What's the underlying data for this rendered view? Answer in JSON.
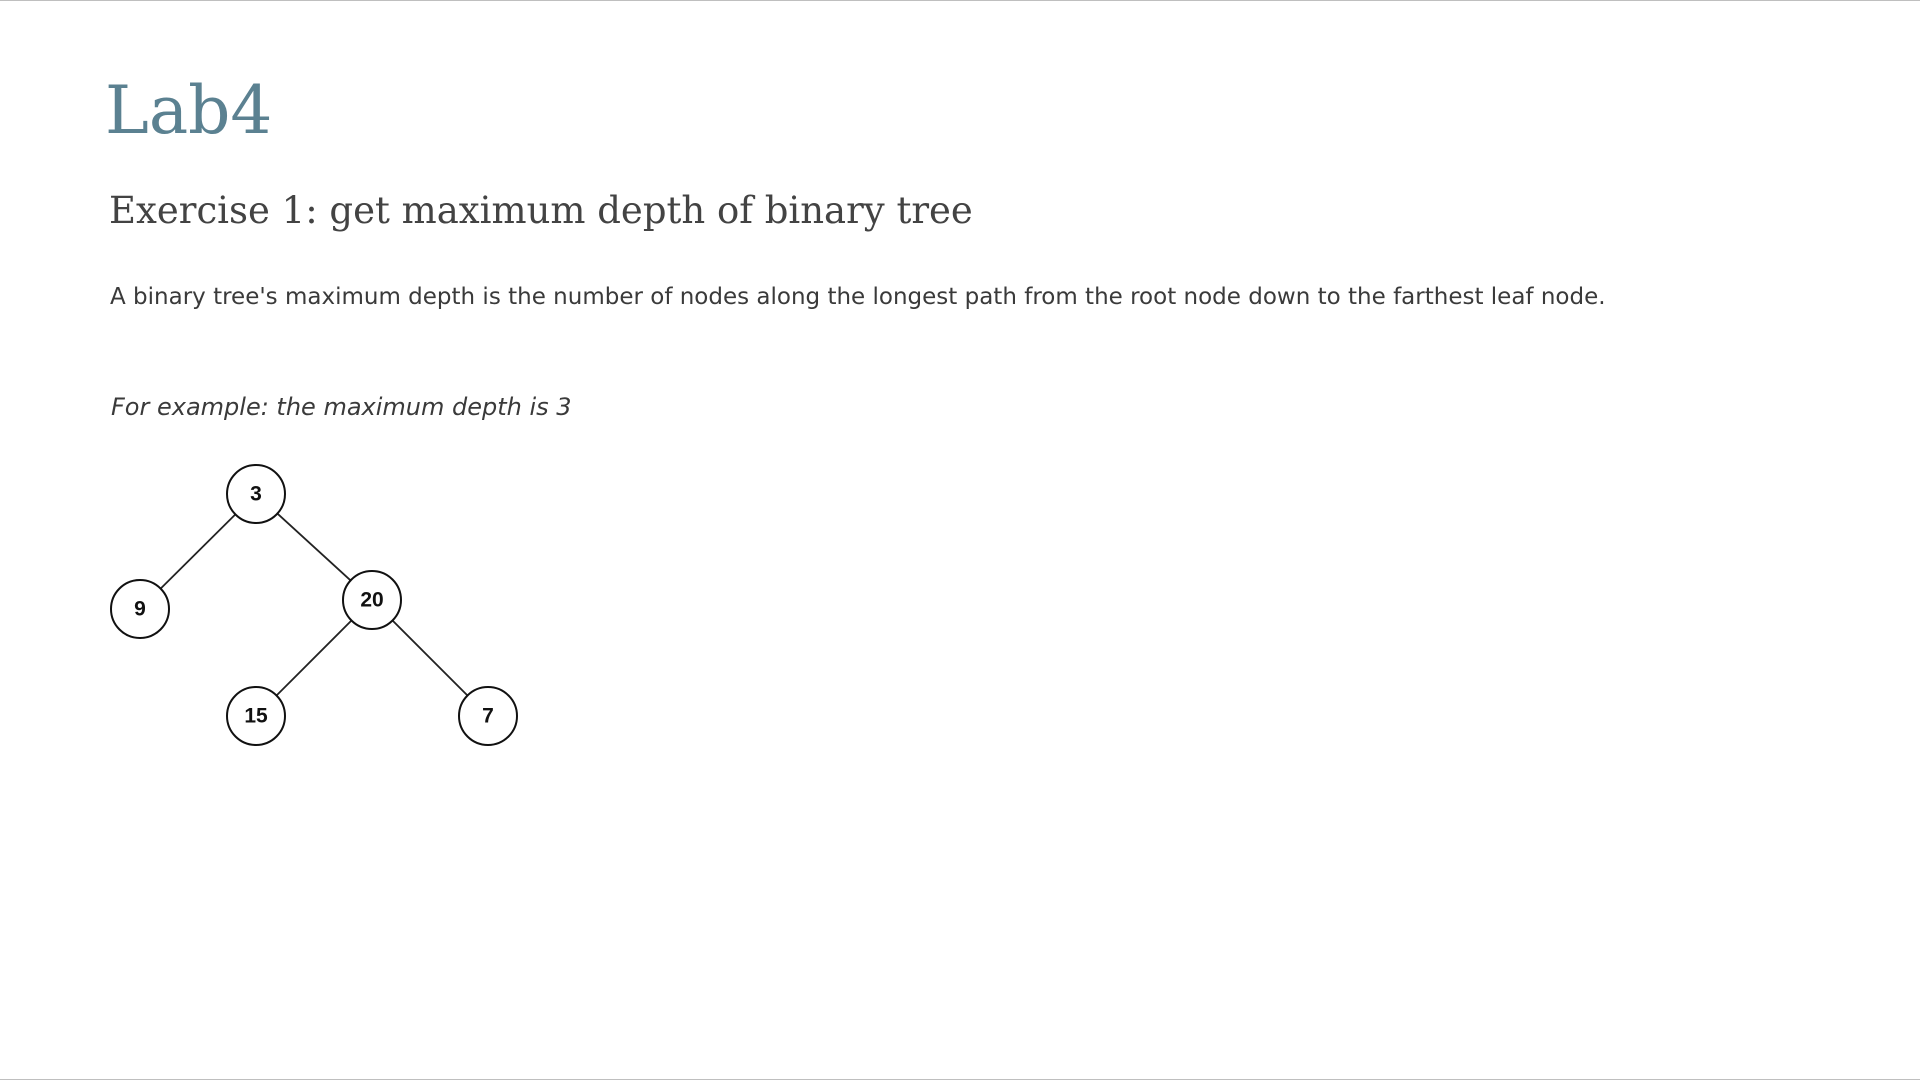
{
  "document": {
    "title": "Lab4",
    "exercise_heading": "Exercise 1: get maximum depth of binary tree",
    "description": "A binary tree's maximum depth is the number of nodes along the longest path from the root node down to the farthest leaf node.",
    "example_caption": "For example: the maximum depth is 3"
  },
  "tree": {
    "nodes": [
      {
        "id": "root",
        "label": "3"
      },
      {
        "id": "left",
        "label": "9"
      },
      {
        "id": "right",
        "label": "20"
      },
      {
        "id": "right-left",
        "label": "15"
      },
      {
        "id": "right-right",
        "label": "7"
      }
    ],
    "edges": [
      {
        "from": "root",
        "to": "left"
      },
      {
        "from": "root",
        "to": "right"
      },
      {
        "from": "right",
        "to": "right-left"
      },
      {
        "from": "right",
        "to": "right-right"
      }
    ]
  }
}
